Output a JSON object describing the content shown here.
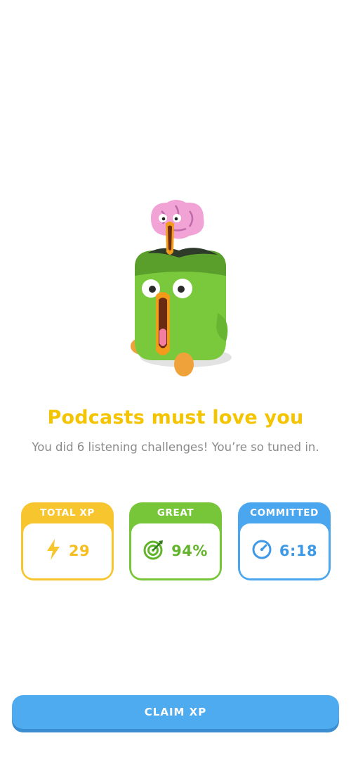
{
  "completion": {
    "headline": "Podcasts must love you",
    "message": "You did 6 listening challenges! You’re so tuned in."
  },
  "stats": [
    {
      "label": "TOTAL XP",
      "value": "29",
      "icon": "lightning-icon",
      "color": "#f7c52e"
    },
    {
      "label": "GREAT",
      "value": "94%",
      "icon": "target-icon",
      "color": "#77c63a"
    },
    {
      "label": "COMMITTED",
      "value": "6:18",
      "icon": "stopwatch-icon",
      "color": "#4aa6ee"
    }
  ],
  "actions": {
    "claim_label": "CLAIM XP"
  },
  "colors": {
    "headline": "#f5c400",
    "button": "#4fabf0"
  }
}
